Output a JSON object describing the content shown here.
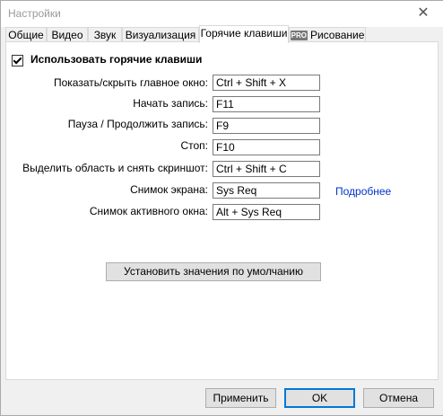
{
  "window": {
    "title": "Настройки",
    "close_glyph": "✕"
  },
  "tabs": [
    {
      "label": "Общие"
    },
    {
      "label": "Видео"
    },
    {
      "label": "Звук"
    },
    {
      "label": "Визуализация"
    },
    {
      "label": "Горячие клавиши",
      "active": true
    },
    {
      "label": "Рисование",
      "badge": "PRO"
    }
  ],
  "hotkeys": {
    "enable_label": "Использовать горячие клавиши",
    "enabled": true,
    "rows": [
      {
        "label": "Показать/скрыть главное окно:",
        "value": "Ctrl + Shift + X"
      },
      {
        "label": "Начать запись:",
        "value": "F11"
      },
      {
        "label": "Пауза / Продолжить запись:",
        "value": "F9"
      },
      {
        "label": "Стоп:",
        "value": "F10"
      },
      {
        "label": "Выделить область и снять скриншот:",
        "value": "Ctrl + Shift + C"
      },
      {
        "label": "Снимок экрана:",
        "value": "Sys Req"
      },
      {
        "label": "Снимок активного окна:",
        "value": "Alt + Sys Req"
      }
    ],
    "more_link": "Подробнее",
    "defaults_button": "Установить значения по умолчанию"
  },
  "footer": {
    "apply": "Применить",
    "ok": "OK",
    "cancel": "Отмена"
  }
}
